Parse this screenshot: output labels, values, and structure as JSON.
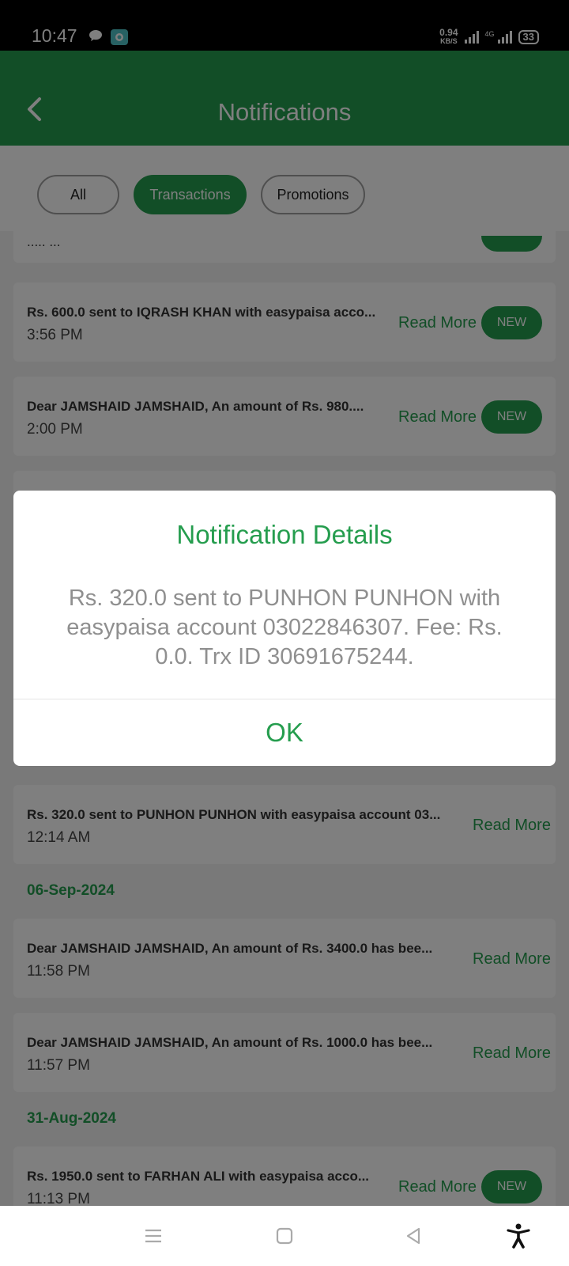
{
  "status_bar": {
    "time": "10:47",
    "net_speed": "0.94",
    "net_unit": "KB/S",
    "network_type": "4G",
    "battery": "33"
  },
  "header": {
    "title": "Notifications"
  },
  "filters": [
    {
      "label": "All",
      "active": false
    },
    {
      "label": "Transactions",
      "active": true
    },
    {
      "label": "Promotions",
      "active": false
    }
  ],
  "list": {
    "read_more_label": "Read More",
    "new_label": "NEW",
    "top_partial_text": "..... ...",
    "items": [
      {
        "text": "Rs. 600.0 sent to IQRASH KHAN with easypaisa acco...",
        "time": "3:56 PM",
        "is_new": true
      },
      {
        "text": "Dear JAMSHAID JAMSHAID, An amount of Rs. 980....",
        "time": "2:00 PM",
        "is_new": true
      },
      {
        "text": "Rs. 320.0 sent to PUNHON PUNHON with easypaisa account 03...",
        "time": "12:14 AM",
        "is_new": false
      }
    ],
    "date_1": "06-Sep-2024",
    "items_2": [
      {
        "text": "Dear JAMSHAID JAMSHAID, An amount of Rs. 3400.0 has bee...",
        "time": "11:58 PM",
        "is_new": false
      },
      {
        "text": "Dear JAMSHAID JAMSHAID, An amount of Rs. 1000.0 has bee...",
        "time": "11:57 PM",
        "is_new": false
      }
    ],
    "date_2": "31-Aug-2024",
    "items_3": [
      {
        "text": "Rs. 1950.0 sent to FARHAN ALI with easypaisa acco...",
        "time": "11:13 PM",
        "is_new": true
      }
    ]
  },
  "dialog": {
    "title": "Notification Details",
    "body": "Rs. 320.0 sent to PUNHON PUNHON with easypaisa account 03022846307. Fee: Rs. 0.0. Trx ID 30691675244.",
    "ok_label": "OK"
  },
  "colors": {
    "brand_green": "#259d4e",
    "scrim": "rgba(0,0,0,0.5)"
  }
}
